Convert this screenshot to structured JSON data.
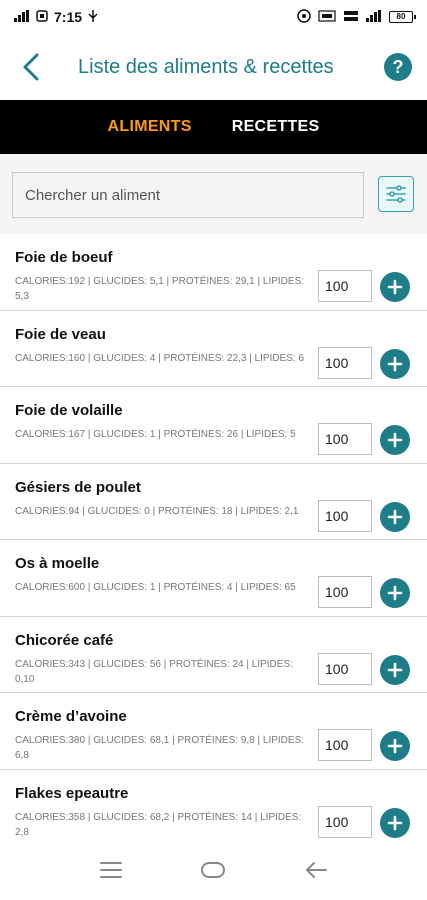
{
  "status_bar": {
    "time": "7:15",
    "battery": "80"
  },
  "header": {
    "title": "Liste des aliments & recettes",
    "help_label": "?"
  },
  "tabs": [
    {
      "label": "ALIMENTS",
      "active": true
    },
    {
      "label": "RECETTES",
      "active": false
    }
  ],
  "search": {
    "placeholder": "Chercher un aliment",
    "value": ""
  },
  "foods": [
    {
      "name": "Foie de boeuf",
      "nutrition": "CALORIES:192 | GLUCIDES: 5,1 | PROTÉINES: 29,1 | LIPIDES: 5,3",
      "quantity": "100"
    },
    {
      "name": "Foie de veau",
      "nutrition": "CALORIES:160 | GLUCIDES: 4 | PROTÉINES: 22,3 | LIPIDES: 6",
      "quantity": "100"
    },
    {
      "name": "Foie de volaille",
      "nutrition": "CALORIES:167 | GLUCIDES: 1 | PROTÉINES: 26 | LIPIDES: 5",
      "quantity": "100"
    },
    {
      "name": "Gésiers de poulet",
      "nutrition": "CALORIES:94 | GLUCIDES: 0 | PROTÉINES: 18 | LIPIDES: 2,1",
      "quantity": "100"
    },
    {
      "name": "Os à moelle",
      "nutrition": "CALORIES:600 | GLUCIDES: 1 | PROTÉINES: 4 | LIPIDES: 65",
      "quantity": "100"
    },
    {
      "name": "Chicorée café",
      "nutrition": "CALORIES:343 | GLUCIDES: 56 | PROTÉINES: 24 | LIPIDES: 0,10",
      "quantity": "100"
    },
    {
      "name": "Crème d’avoine",
      "nutrition": "CALORIES:380 | GLUCIDES: 68,1 | PROTÉINES: 9,8 | LIPIDES: 6,8",
      "quantity": "100"
    },
    {
      "name": "Flakes epeautre",
      "nutrition": "CALORIES:358 | GLUCIDES: 68,2 | PROTÉINES: 14 | LIPIDES: 2,8",
      "quantity": "100"
    }
  ],
  "colors": {
    "accent": "#1f7c89",
    "tab_active": "#ff9a14",
    "tab_bar": "#000000"
  },
  "icons": {
    "back": "chevron-left-icon",
    "help": "help-icon",
    "filter": "filter-sliders-icon",
    "add": "plus-icon",
    "nav_menu": "menu-icon",
    "nav_home": "home-icon",
    "nav_back": "back-arrow-icon"
  }
}
